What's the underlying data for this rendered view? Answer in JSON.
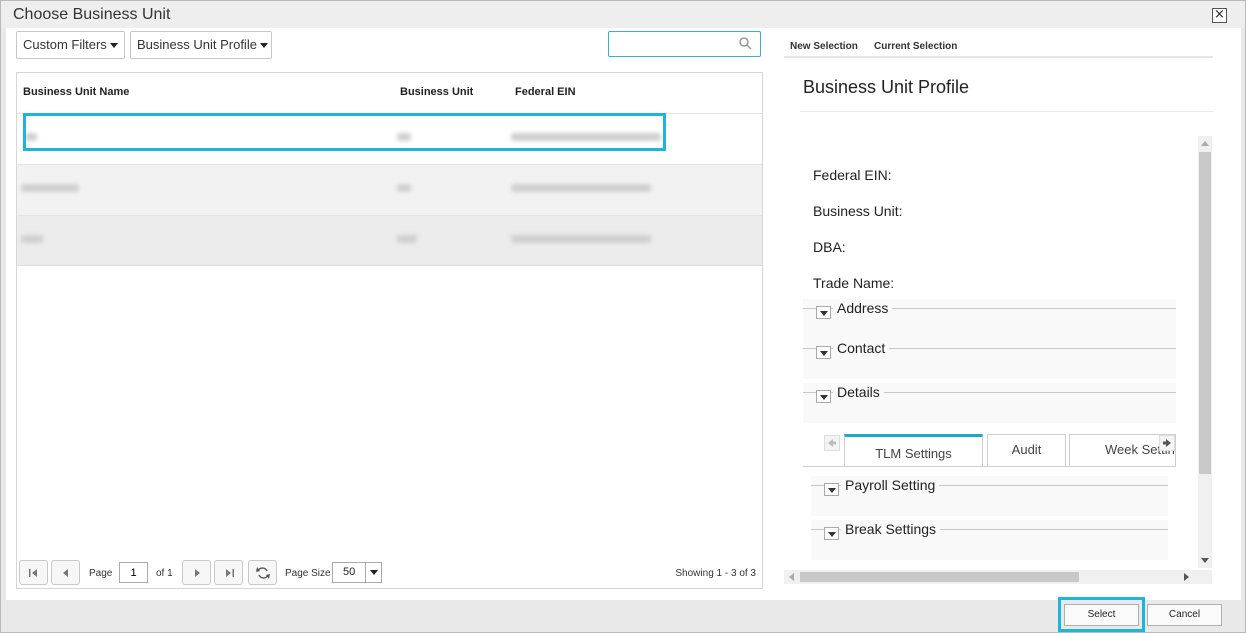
{
  "dialog": {
    "title": "Choose Business Unit",
    "close_symbol": "×"
  },
  "filters": {
    "custom_filters_label": "Custom Filters",
    "profile_filter_label": "Business Unit Profile",
    "search_placeholder": "",
    "search_value": ""
  },
  "grid": {
    "columns": [
      "Business Unit Name",
      "Business Unit",
      "Federal EIN"
    ],
    "rows_redacted": true
  },
  "pager": {
    "page_label": "Page",
    "page_value": "1",
    "of_label": "of 1",
    "page_size_label": "Page Size",
    "page_size_value": "50",
    "showing_text": "Showing 1 - 3 of 3"
  },
  "right_tabs": {
    "new_selection": "New Selection",
    "current_selection": "Current Selection"
  },
  "profile": {
    "title": "Business Unit Profile",
    "fields": [
      "Federal EIN:",
      "Business Unit:",
      "DBA:",
      "Trade Name:"
    ],
    "sections": [
      "Address",
      "Contact",
      "Details"
    ],
    "inner_tabs": [
      "TLM Settings",
      "Audit",
      "Week Settings"
    ],
    "subsections": [
      "Payroll Setting",
      "Break Settings"
    ]
  },
  "footer": {
    "select_label": "Select",
    "cancel_label": "Cancel"
  },
  "colors": {
    "highlight": "#1fb4dc",
    "active_tab": "#1fa8c9"
  }
}
